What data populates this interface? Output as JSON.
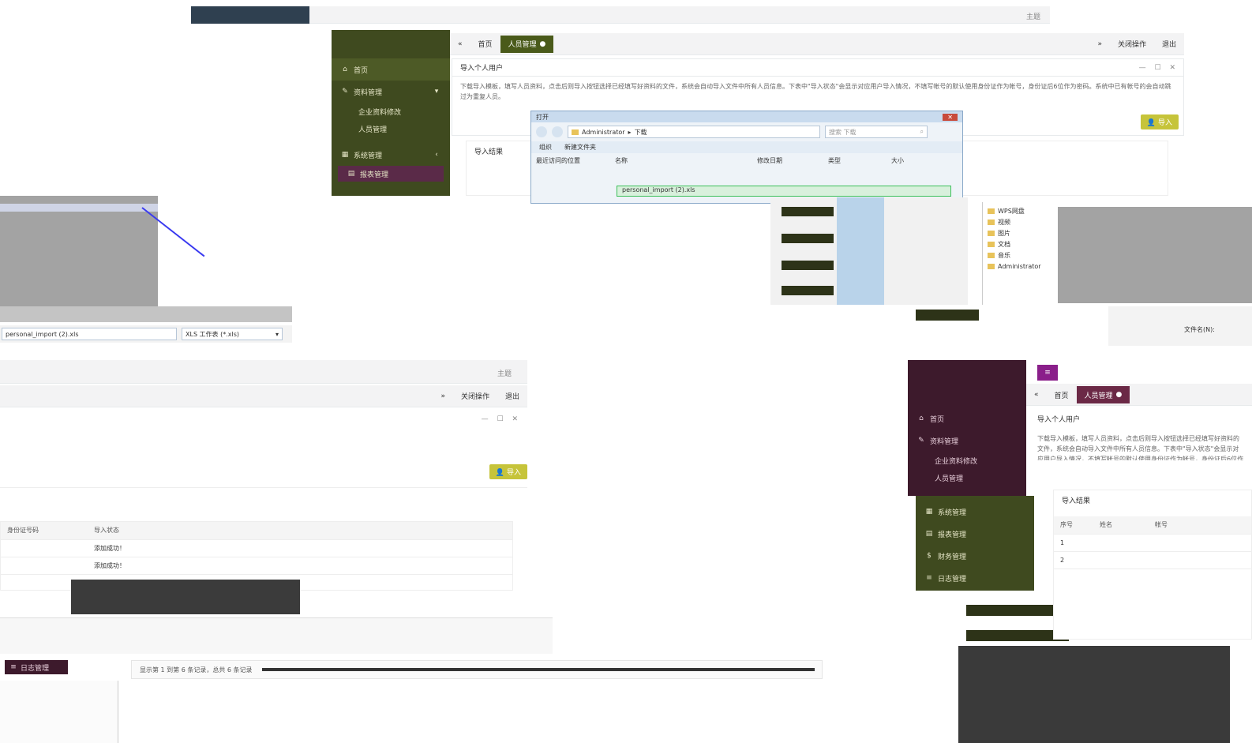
{
  "colors": {
    "dark_topbar": "#2f4050",
    "olive_sidebar": "#3f4a1f",
    "plum_sidebar": "#3d1a2c",
    "import_button": "#c6c43a",
    "tab_active_olive": "#4a5a1a",
    "tab_active_plum": "#6b2946"
  },
  "topbar": {
    "right_label": "主题"
  },
  "sidebar": {
    "items": [
      {
        "label": "首页",
        "icon": "home-icon"
      },
      {
        "label": "资料管理",
        "icon": "edit-icon"
      },
      {
        "label": "企业资料修改",
        "sub": true
      },
      {
        "label": "人员管理",
        "sub": true
      },
      {
        "label": "系统管理",
        "icon": "grid-icon"
      },
      {
        "label": "报表管理",
        "icon": "chart-icon"
      },
      {
        "label": "财务管理",
        "icon": "dollar-icon"
      },
      {
        "label": "日志管理",
        "icon": "list-icon"
      }
    ]
  },
  "tabs": {
    "back": "«",
    "home": "首页",
    "active": "人员管理",
    "forward": "»",
    "close_ops": "关闭操作",
    "logout": "退出"
  },
  "modal": {
    "title": "导入个人用户",
    "hint": "下载导入模板，填写人员资料，点击后则导入按钮选择已经填写好资料的文件，系统会自动导入文件中所有人员信息。下表中\"导入状态\"会显示对应用户导入情况，不填写帐号的默认使用身份证作为帐号，身份证后6位作为密码。系统中已有帐号的会自动跳过为重复人员。",
    "import_button": "导入",
    "result_title": "导入结果"
  },
  "table": {
    "headers": [
      "序号",
      "姓名",
      "帐号",
      "身份证号码",
      "导入状态"
    ],
    "rows": [
      {
        "no": "1",
        "status": "添加成功！"
      },
      {
        "no": "2",
        "status": "添加成功！"
      }
    ],
    "footer": "显示第 1 到第 6 条记录，总共 6 条记录"
  },
  "file_dialog": {
    "title": "打开",
    "path": [
      "Administrator",
      "下载"
    ],
    "search_placeholder": "搜索 下载",
    "organize": "组织",
    "new_folder": "新建文件夹",
    "col_name": "名称",
    "col_modified": "修改日期",
    "col_type": "类型",
    "col_size": "大小",
    "recent_places": "最近访问的位置",
    "file_name": "personal_import (2).xls",
    "filetype_filter": "XLS 工作表 (*.xls)",
    "filename_label": "文件名(N):",
    "filename_value": "personal_import (2).xls",
    "tree": [
      "WPS网盘",
      "视频",
      "图片",
      "文档",
      "音乐",
      "Administrator"
    ]
  }
}
